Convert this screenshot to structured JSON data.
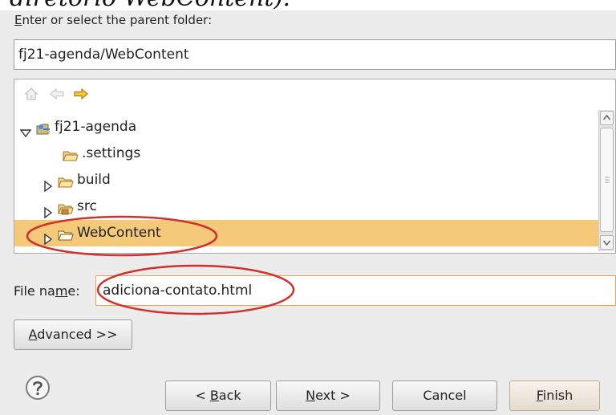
{
  "cut_title": "diretório WebContent):",
  "folder_label": {
    "mnemonic": "E",
    "rest": "nter or select the parent folder:"
  },
  "folder_path": "fj21-agenda/WebContent",
  "nav": {
    "home_icon": "home-icon",
    "back_icon": "back-arrow-icon",
    "forward_icon": "forward-arrow-icon"
  },
  "tree": {
    "items": [
      {
        "label": "fj21-agenda",
        "icon": "project-icon",
        "expanded": true
      },
      {
        "label": ".settings",
        "icon": "folder-icon"
      },
      {
        "label": "build",
        "icon": "folder-icon"
      },
      {
        "label": "src",
        "icon": "source-folder-icon"
      },
      {
        "label": "WebContent",
        "icon": "folder-icon",
        "selected": true
      }
    ]
  },
  "filename": {
    "label_pre": "File na",
    "label_mnemonic": "m",
    "label_post": "e:",
    "value": "adiciona-contato.html"
  },
  "advanced_button": {
    "mnemonic": "A",
    "rest": "dvanced >>"
  },
  "buttons": {
    "back": {
      "pre": "< ",
      "mnemonic": "B",
      "rest": "ack"
    },
    "next": {
      "mnemonic": "N",
      "rest": "ext >"
    },
    "cancel": "Cancel",
    "finish": {
      "mnemonic": "F",
      "rest": "inish"
    }
  },
  "help_icon": "help-question-icon",
  "colors": {
    "selection": "#f5c97a",
    "highlight_circle": "#d0312d",
    "focus_border": "#f0a04b"
  }
}
